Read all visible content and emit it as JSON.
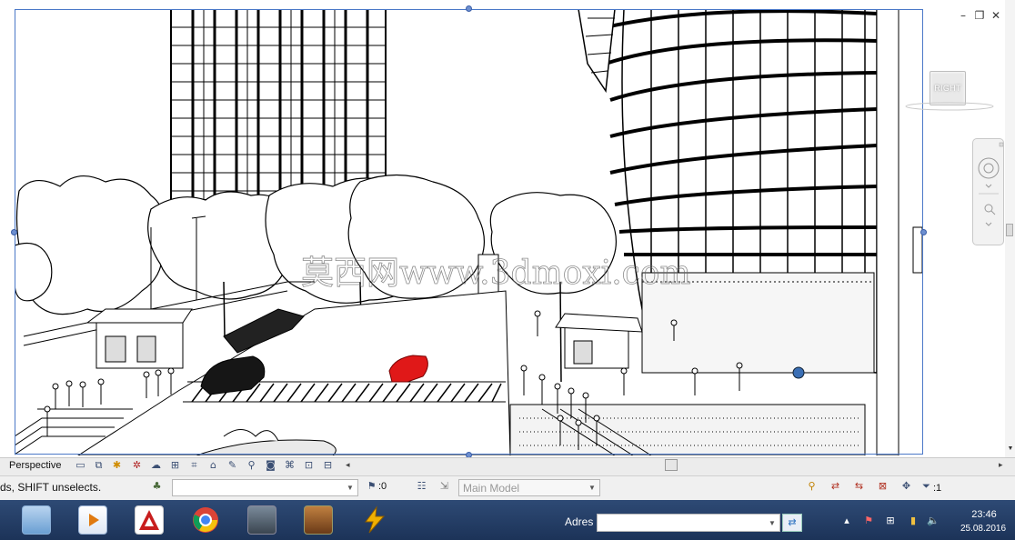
{
  "viewport": {
    "viewcube_label": "RIGHT",
    "watermark": "莫西网www.3dmoxi.com"
  },
  "view_bar": {
    "label": "Perspective"
  },
  "status_bar": {
    "hint": "ds, SHIFT unselects.",
    "selection_count": ":0",
    "model_placeholder": "Main Model",
    "filter_count": ":1"
  },
  "taskbar": {
    "address_label": "Adres",
    "time": "23:46",
    "date": "25.08.2016"
  },
  "colors": {
    "accent_blue": "#4a78c8",
    "taskbar": "#1c3358",
    "car_red": "#e01818",
    "car_black": "#161616"
  }
}
